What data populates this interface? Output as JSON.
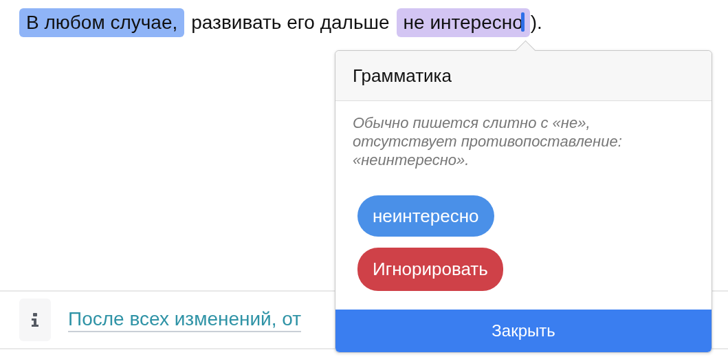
{
  "sentence": [
    {
      "text": "В любом случае,",
      "kind": "highlight",
      "color": "#8fb4f7",
      "caret": false
    },
    {
      "text": "развивать его дальше",
      "kind": "plain",
      "caret": false
    },
    {
      "text": "не интересно",
      "kind": "highlight",
      "color": "#d3c5f3",
      "caret": true
    },
    {
      "text": ").",
      "kind": "plain",
      "caret": false
    }
  ],
  "popover": {
    "title": "Грамматика",
    "explanation": "Обычно пишется слитно с «не», отсутствует противопоставление: «неинтересно».",
    "suggestions": [
      "неинтересно"
    ],
    "ignore": "Игнорировать",
    "close": "Закрыть"
  },
  "notice": {
    "text": "После всех изменений, от"
  }
}
